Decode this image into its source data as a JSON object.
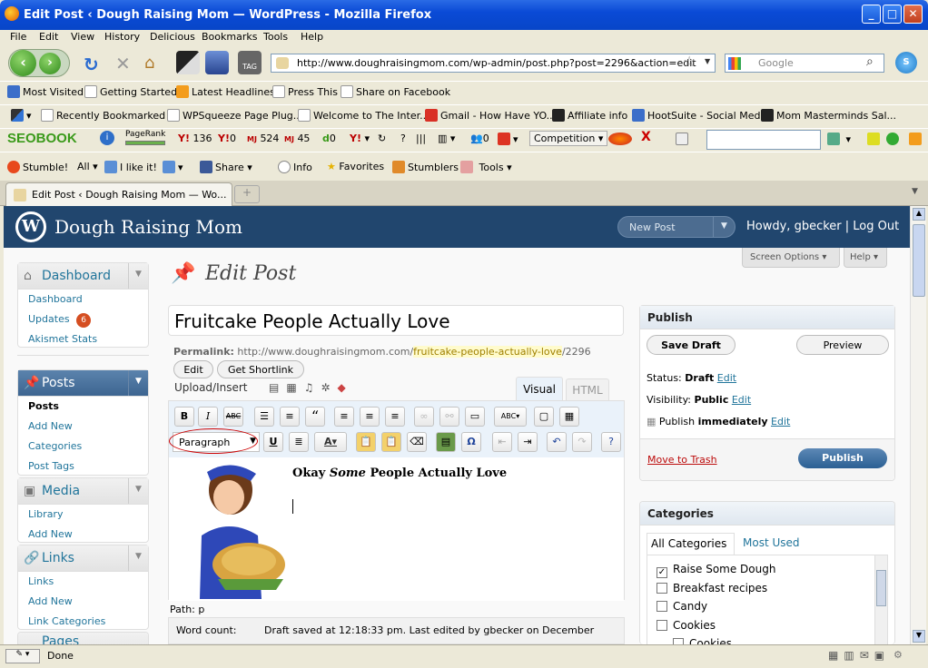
{
  "window": {
    "title": "Edit Post ‹ Dough Raising Mom — WordPress - Mozilla Firefox"
  },
  "menu": [
    "File",
    "Edit",
    "View",
    "History",
    "Delicious",
    "Bookmarks",
    "Tools",
    "Help"
  ],
  "nav": {
    "url": "http://www.doughraisingmom.com/wp-admin/post.php?post=2296&action=edit",
    "search_placeholder": "Google"
  },
  "bookmarks1": [
    "Most Visited",
    "Getting Started",
    "Latest Headlines",
    "Press This",
    "Share on Facebook"
  ],
  "bookmarks2": [
    "Recently Bookmarked",
    "WPSqueeze Page Plug...",
    "Welcome to The Inter...",
    "Gmail - How Have YO...",
    "Affiliate info",
    "HootSuite - Social Med...",
    "Mom Masterminds Sal..."
  ],
  "seo": {
    "brand": "SEOBOOK",
    "pagerank": "PageRank",
    "y136": "136",
    "y0": "0",
    "mj524": "524",
    "mj45": "45",
    "d0": "0",
    "q": "?",
    "c0": "0",
    "competition": "Competition"
  },
  "stumble": {
    "stumble": "Stumble!",
    "all": "All",
    "ilike": "I like it!",
    "share": "Share",
    "info": "Info",
    "favorites": "Favorites",
    "stumblers": "Stumblers",
    "tools": "Tools"
  },
  "tab": {
    "label": "Edit Post ‹ Dough Raising Mom — Wo..."
  },
  "wp": {
    "site": "Dough Raising Mom",
    "logo": "W",
    "new_post": "New Post",
    "howdy": "Howdy, gbecker | Log Out",
    "screen_options": "Screen Options",
    "help": "Help"
  },
  "sidebar": {
    "dashboard": "Dashboard",
    "dash_items": [
      "Dashboard",
      "Updates",
      "Akismet Stats"
    ],
    "updates_count": "6",
    "posts": "Posts",
    "posts_items": [
      "Posts",
      "Add New",
      "Categories",
      "Post Tags"
    ],
    "media": "Media",
    "media_items": [
      "Library",
      "Add New"
    ],
    "links": "Links",
    "links_items": [
      "Links",
      "Add New",
      "Link Categories"
    ],
    "pages": "Pages"
  },
  "editor": {
    "heading": "Edit Post",
    "title": "Fruitcake People Actually Love",
    "permalink_label": "Permalink:",
    "permalink_base": "http://www.doughraisingmom.com/",
    "permalink_slug": "fruitcake-people-actually-love",
    "permalink_id": "/2296",
    "edit": "Edit",
    "shortlink": "Get Shortlink",
    "upload": "Upload/Insert",
    "tab_visual": "Visual",
    "tab_html": "HTML",
    "format": "Paragraph",
    "content_pre": "Okay ",
    "content_em": "Some",
    "content_post": " People Actually Love",
    "path": "Path: p",
    "word_count": "Word count:",
    "draft_saved": "Draft saved at 12:18:33 pm. Last edited by gbecker on December"
  },
  "publish": {
    "title": "Publish",
    "save_draft": "Save Draft",
    "preview": "Preview",
    "status_label": "Status:",
    "status": "Draft",
    "visibility_label": "Visibility:",
    "visibility": "Public",
    "publish_label": "Publish",
    "publish_when": "immediately",
    "edit": "Edit",
    "trash": "Move to Trash",
    "publish_btn": "Publish"
  },
  "categories": {
    "title": "Categories",
    "tab_all": "All Categories",
    "tab_used": "Most Used",
    "items": [
      {
        "label": "Raise Some Dough",
        "checked": "✓"
      },
      {
        "label": "Breakfast recipes",
        "checked": ""
      },
      {
        "label": "Candy",
        "checked": ""
      },
      {
        "label": "Cookies",
        "checked": ""
      },
      {
        "label": "Cookies",
        "checked": ""
      }
    ]
  },
  "status": {
    "text": "Done"
  }
}
